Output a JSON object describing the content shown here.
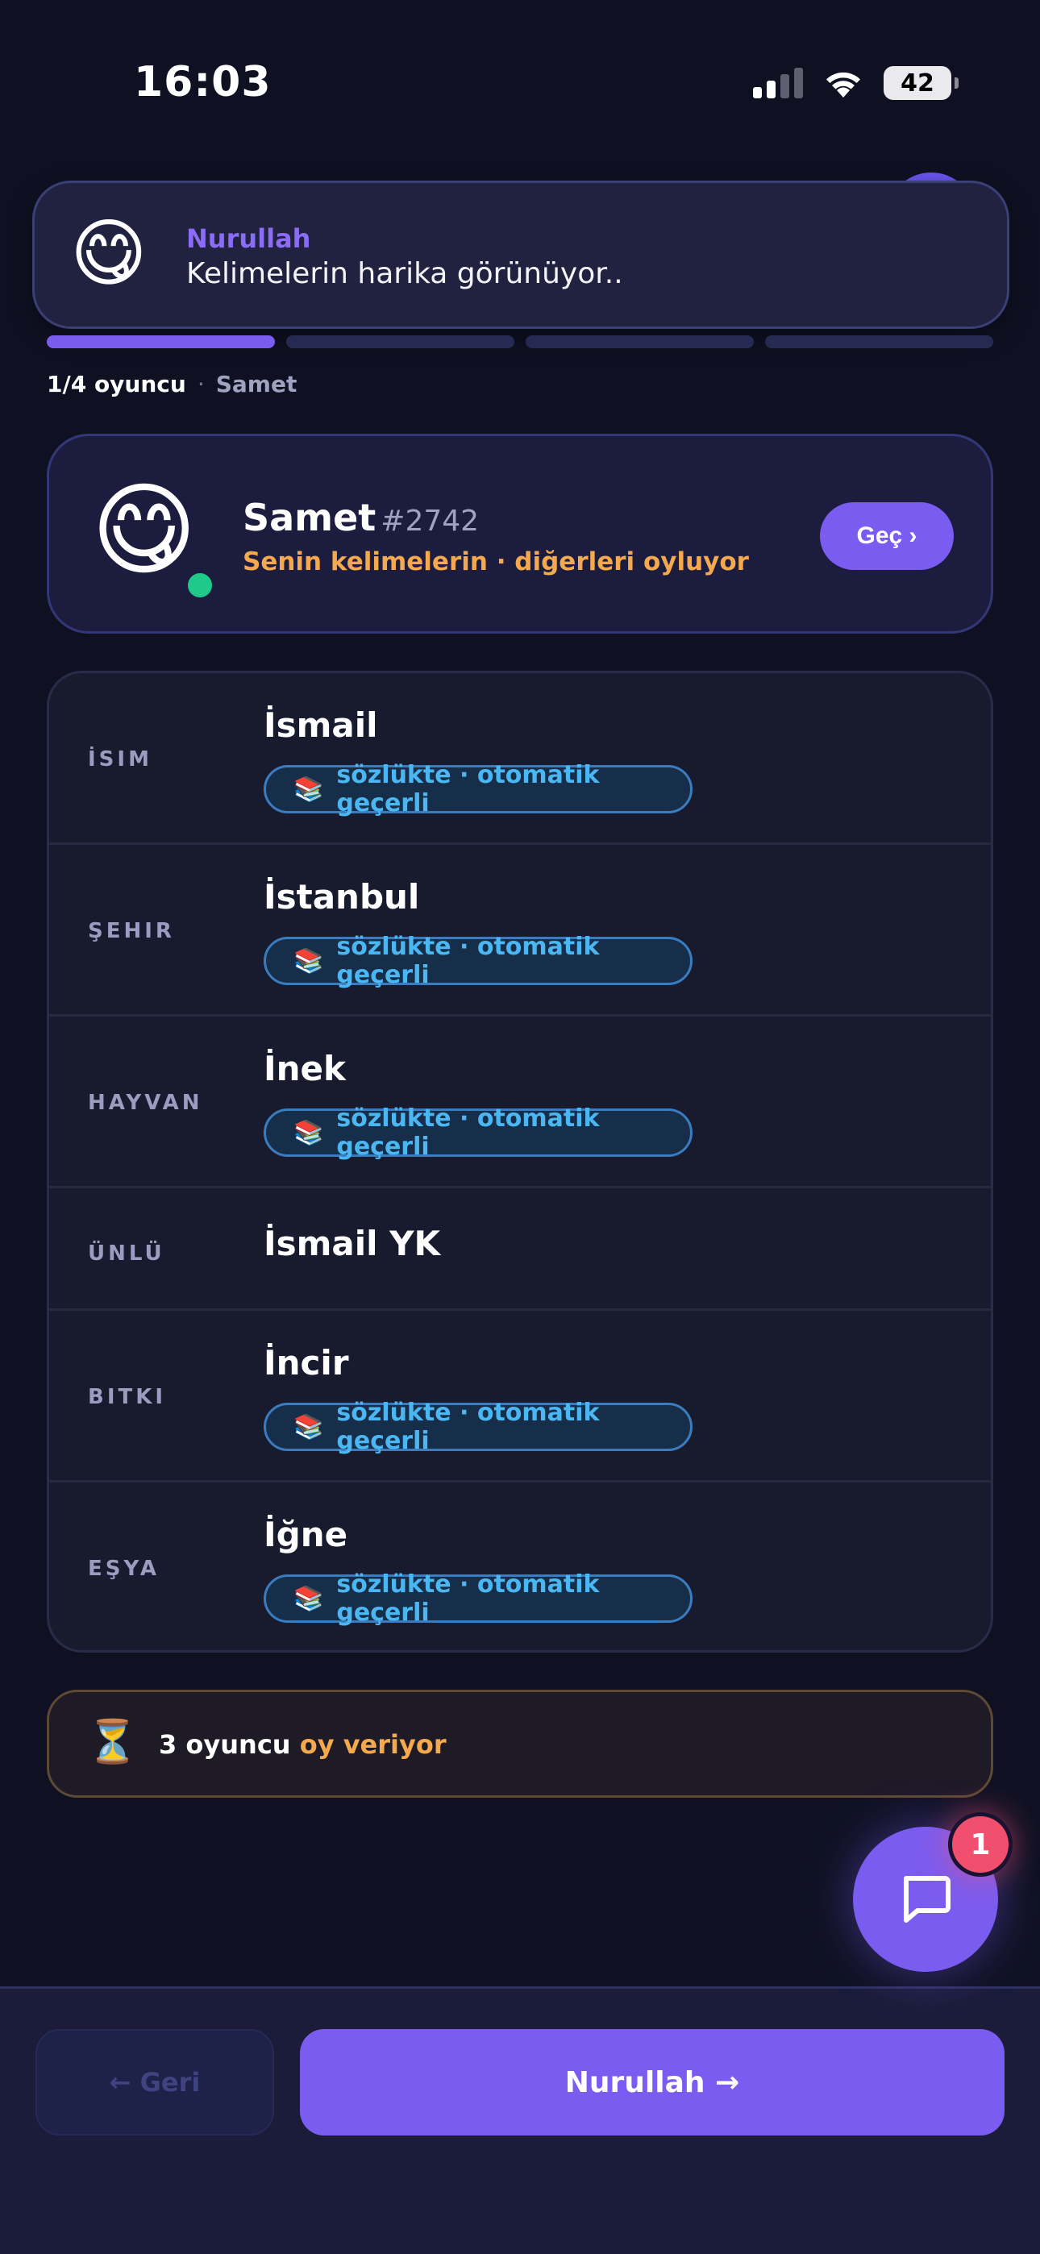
{
  "status_bar": {
    "time": "16:03",
    "battery": "42"
  },
  "toast": {
    "emoji": "😋",
    "sender": "Nurullah",
    "message": "Kelimelerin harika görünüyor.."
  },
  "progress": {
    "segments": 4,
    "active": 1,
    "count_text": "1/4 oyuncu",
    "separator": "·",
    "current_player": "Samet"
  },
  "player": {
    "emoji": "😋",
    "name": "Samet",
    "tag": "#2742",
    "subtitle": "Senin kelimelerin · diğerleri oyluyor",
    "skip_label": "Geç ›",
    "online": true
  },
  "words": [
    {
      "category": "İSIM",
      "value": "İsmail",
      "badge": "sözlükte · otomatik geçerli",
      "badge_icon": "📚"
    },
    {
      "category": "ŞEHIR",
      "value": "İstanbul",
      "badge": "sözlükte · otomatik geçerli",
      "badge_icon": "📚"
    },
    {
      "category": "HAYVAN",
      "value": "İnek",
      "badge": "sözlükte · otomatik geçerli",
      "badge_icon": "📚"
    },
    {
      "category": "ÜNLÜ",
      "value": "İsmail YK",
      "badge": null,
      "badge_icon": null
    },
    {
      "category": "BITKI",
      "value": "İncir",
      "badge": "sözlükte · otomatik geçerli",
      "badge_icon": "📚"
    },
    {
      "category": "EŞYA",
      "value": "İğne",
      "badge": "sözlükte · otomatik geçerli",
      "badge_icon": "📚"
    }
  ],
  "voting": {
    "icon": "⏳",
    "count_text": "3 oyuncu",
    "status_text": "oy veriyor"
  },
  "chat": {
    "unread": "1",
    "icon": "chat-bubble-icon"
  },
  "nav": {
    "back_label": "← Geri",
    "next_label": "Nurullah →"
  },
  "colors": {
    "accent": "#7b5cf0",
    "warning": "#f5a94e",
    "online": "#1ec98a",
    "badge_text": "#4ab6f2",
    "notification": "#f0506e"
  }
}
